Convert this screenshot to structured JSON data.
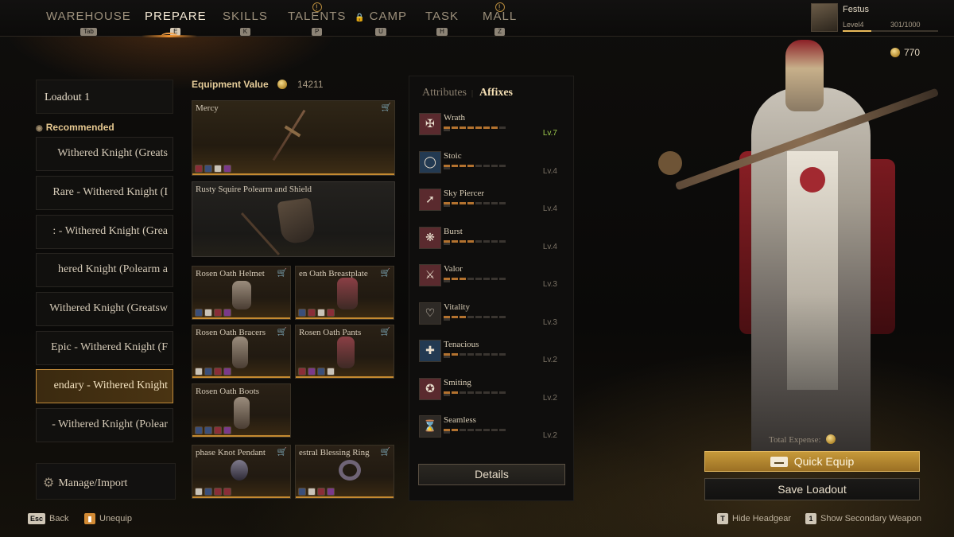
{
  "nav": {
    "tabs": [
      {
        "label": "WAREHOUSE",
        "key": "Tab"
      },
      {
        "label": "PREPARE",
        "key": "E"
      },
      {
        "label": "SKILLS",
        "key": "K"
      },
      {
        "label": "TALENTS",
        "key": "P"
      },
      {
        "label": "CAMP",
        "key": "U"
      },
      {
        "label": "TASK",
        "key": "H"
      },
      {
        "label": "MALL",
        "key": "Z"
      }
    ],
    "alert_symbol": "!"
  },
  "profile": {
    "name": "Festus",
    "level": "Level4",
    "xp": "301/1000",
    "xp_fraction": 0.301
  },
  "currency": {
    "amount": "770"
  },
  "loadout": {
    "current": "Loadout 1",
    "recommended_label": "Recommended",
    "items": [
      "Withered Knight (Greats",
      "Rare - Withered Knight (I",
      ": - Withered Knight (Grea",
      "hered Knight (Polearm a",
      "Withered Knight (Greatsw",
      "Epic - Withered Knight (F",
      "endary - Withered Knight",
      "- Withered Knight (Polear"
    ],
    "selected_index": 6,
    "manage_label": "Manage/Import"
  },
  "equipment": {
    "value_label": "Equipment Value",
    "value": "14211",
    "slots": [
      {
        "name": "Mercy"
      },
      {
        "name": "Rusty Squire Polearm and Shield"
      },
      {
        "name": "Rosen Oath Helmet"
      },
      {
        "name": "en Oath Breastplate"
      },
      {
        "name": "Rosen Oath Bracers"
      },
      {
        "name": "Rosen Oath Pants"
      },
      {
        "name": "Rosen Oath Boots"
      },
      {
        "name": "phase Knot Pendant"
      },
      {
        "name": "estral Blessing Ring"
      }
    ]
  },
  "attributes": {
    "tab_attributes": "Attributes",
    "tab_affixes": "Affixes",
    "affixes": [
      {
        "name": "Wrath",
        "level": "Lv.7",
        "filled": 7,
        "icon": "wrath-icon"
      },
      {
        "name": "Stoic",
        "level": "Lv.4",
        "filled": 4,
        "icon": "stoic-icon"
      },
      {
        "name": "Sky Piercer",
        "level": "Lv.4",
        "filled": 4,
        "icon": "sky-piercer-icon"
      },
      {
        "name": "Burst",
        "level": "Lv.4",
        "filled": 4,
        "icon": "burst-icon"
      },
      {
        "name": "Valor",
        "level": "Lv.3",
        "filled": 3,
        "icon": "valor-icon"
      },
      {
        "name": "Vitality",
        "level": "Lv.3",
        "filled": 3,
        "icon": "vitality-icon"
      },
      {
        "name": "Tenacious",
        "level": "Lv.2",
        "filled": 2,
        "icon": "tenacious-icon"
      },
      {
        "name": "Smiting",
        "level": "Lv.2",
        "filled": 2,
        "icon": "smiting-icon"
      },
      {
        "name": "Seamless",
        "level": "Lv.2",
        "filled": 2,
        "icon": "seamless-icon"
      }
    ],
    "details_label": "Details"
  },
  "actions": {
    "total_expense_label": "Total Expense:",
    "quick_equip": "Quick Equip",
    "save_loadout": "Save Loadout"
  },
  "hints": {
    "back_key": "Esc",
    "back": "Back",
    "unequip": "Unequip",
    "hide_headgear_key": "T",
    "hide_headgear": "Hide Headgear",
    "secondary_key": "1",
    "secondary": "Show Secondary Weapon"
  },
  "colors": {
    "accent_gold": "#c79a3a",
    "accent_orange": "#f0922f",
    "level_green": "#9fcc4e"
  }
}
